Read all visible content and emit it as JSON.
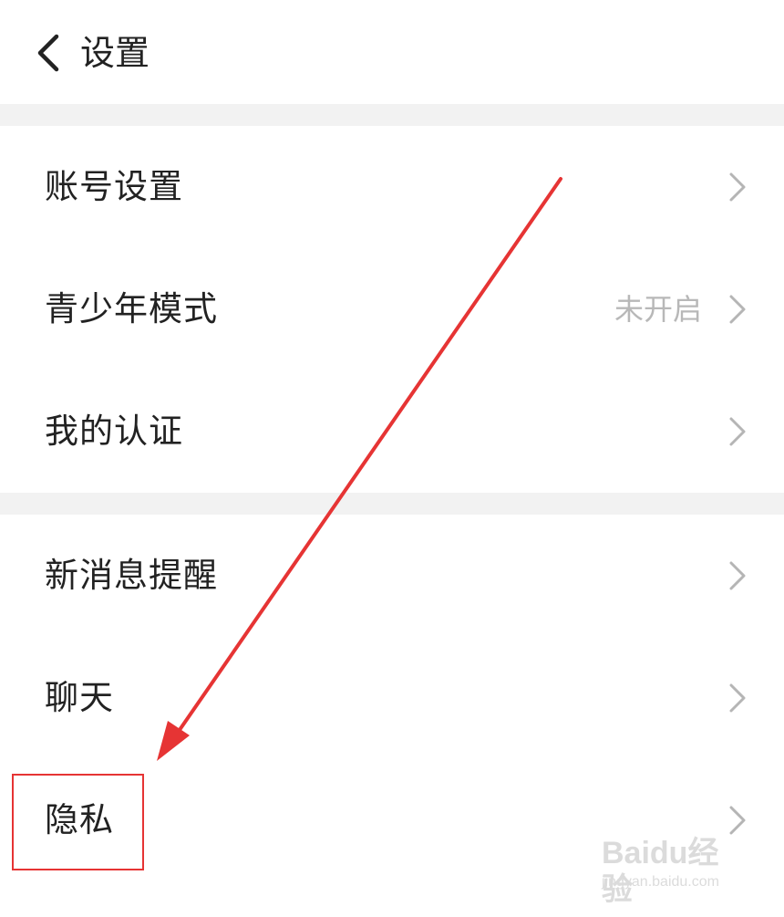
{
  "header": {
    "title": "设置"
  },
  "section_1": {
    "items": [
      {
        "label": "账号设置",
        "value": ""
      },
      {
        "label": "青少年模式",
        "value": "未开启"
      },
      {
        "label": "我的认证",
        "value": ""
      }
    ]
  },
  "section_2": {
    "items": [
      {
        "label": "新消息提醒",
        "value": ""
      },
      {
        "label": "聊天",
        "value": ""
      },
      {
        "label": "隐私",
        "value": ""
      }
    ]
  },
  "icons": {
    "back": "back-arrow-icon",
    "row_chevron": "chevron-right-icon"
  },
  "annotation": {
    "highlighted_item": "隐私",
    "color": "#e63434"
  },
  "watermark": {
    "brand": "Baidu经验",
    "url": "jingyan.baidu.com"
  },
  "colors": {
    "background": "#ffffff",
    "divider": "#f2f2f2",
    "text": "#222222",
    "secondary_text": "#b8b8b8",
    "chevron": "#b5b5b5"
  }
}
